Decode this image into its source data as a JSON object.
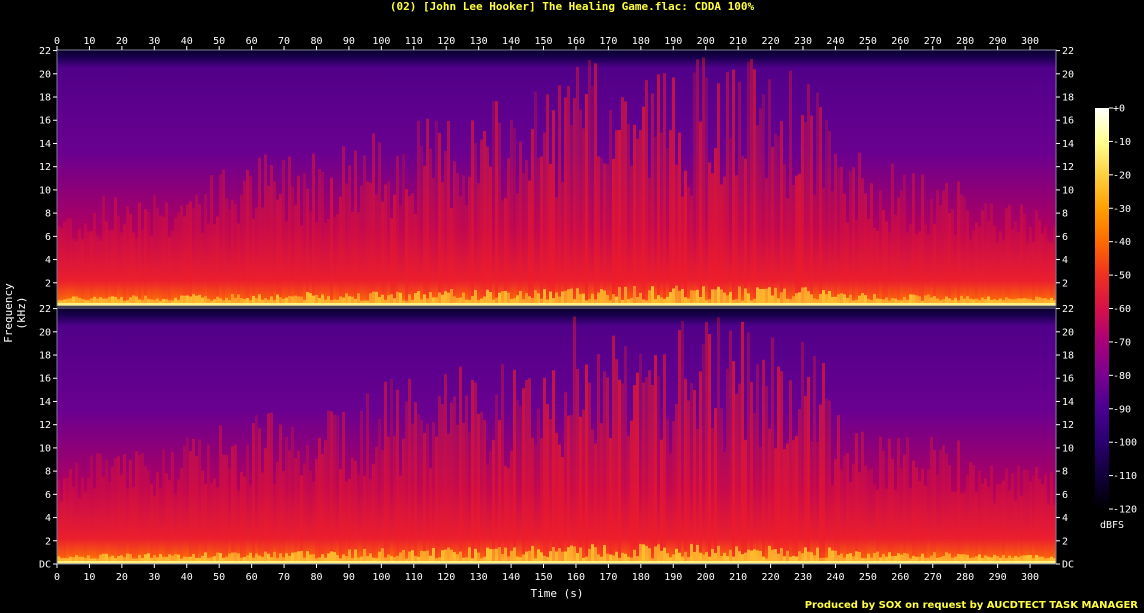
{
  "title": "(02) [John Lee Hooker] The Healing Game.flac: CDDA 100%",
  "footer": "Produced by SOX on request by AUCDTECT TASK MANAGER",
  "chart_data": {
    "type": "heatmap",
    "title": "(02) [John Lee Hooker] The Healing Game.flac: CDDA 100%",
    "xlabel": "Time (s)",
    "ylabel": "Frequency (kHz)",
    "xlim": [
      0,
      308
    ],
    "ylim": [
      0,
      22.05
    ],
    "x_ticks": [
      "0",
      "10",
      "20",
      "30",
      "40",
      "50",
      "60",
      "70",
      "80",
      "90",
      "100",
      "110",
      "120",
      "130",
      "140",
      "150",
      "160",
      "170",
      "180",
      "190",
      "200",
      "210",
      "220",
      "230",
      "240",
      "250",
      "260",
      "270",
      "280",
      "290",
      "300"
    ],
    "y_ticks": [
      "DC",
      "2",
      "4",
      "6",
      "8",
      "10",
      "12",
      "14",
      "16",
      "18",
      "20",
      "22"
    ],
    "channels": [
      "Channel 1",
      "Channel 2"
    ],
    "colorbar": {
      "label": "dBFS",
      "range": [
        -120,
        0
      ],
      "ticks": [
        "+0",
        "-10",
        "-20",
        "-30",
        "-40",
        "-50",
        "-60",
        "-70",
        "-80",
        "-90",
        "-100",
        "-110",
        "-120"
      ],
      "colors": [
        "#000000",
        "#10003a",
        "#2a0070",
        "#4a0090",
        "#7a0090",
        "#a8007a",
        "#d8104a",
        "#f03020",
        "#ff6a00",
        "#ffa000",
        "#ffd040",
        "#ffff90",
        "#ffffff"
      ]
    },
    "energy_profile_note_free": [
      0.3,
      0.35,
      0.4,
      0.38,
      0.45,
      0.5,
      0.55,
      0.6,
      0.62,
      0.65,
      0.7,
      0.72,
      0.78,
      0.8,
      0.85,
      0.95,
      1.0,
      1.0,
      1.0,
      1.0,
      1.0,
      1.0,
      0.95,
      0.9,
      0.55,
      0.5,
      0.45,
      0.45,
      0.35,
      0.3,
      0.28
    ]
  }
}
